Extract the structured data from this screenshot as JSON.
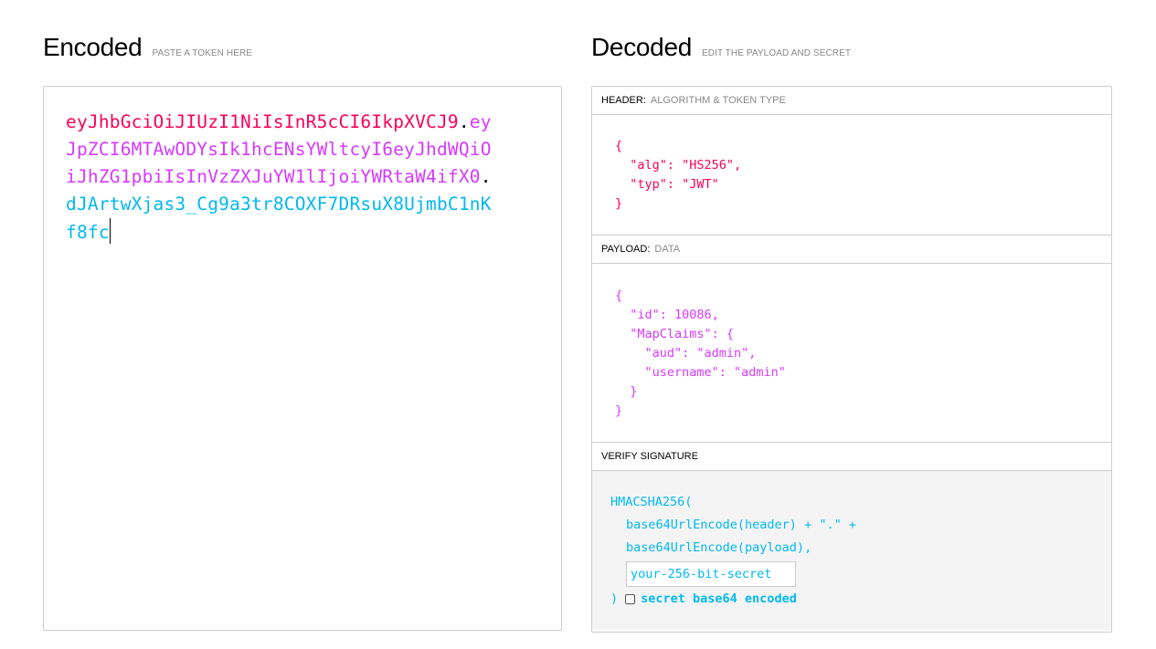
{
  "encoded": {
    "title": "Encoded",
    "subtitle": "PASTE A TOKEN HERE",
    "token": {
      "header": "eyJhbGciOiJIUzI1NiIsInR5cCI6IkpXVCJ9",
      "dot1": ".",
      "payload": "eyJpZCI6MTAwODYsIk1hcENsYWltcyI6eyJhdWQiOiJhZG1pbiIsInVzZXJuYW1lIjoiYWRtaW4ifX0",
      "dot2": ".",
      "signature": "dJArtwXjas3_Cg9a3tr8COXF7DRsuX8UjmbC1nKf8fc"
    }
  },
  "decoded": {
    "title": "Decoded",
    "subtitle": "EDIT THE PAYLOAD AND SECRET",
    "header_section": {
      "label": "HEADER:",
      "hint": "ALGORITHM & TOKEN TYPE",
      "lines": [
        "{",
        "  \"alg\": \"HS256\",",
        "  \"typ\": \"JWT\"",
        "}"
      ]
    },
    "payload_section": {
      "label": "PAYLOAD:",
      "hint": "DATA",
      "lines": [
        "{",
        "  \"id\": 10086,",
        "  \"MapClaims\": {",
        "    \"aud\": \"admin\",",
        "    \"username\": \"admin\"",
        "  }",
        "}"
      ]
    },
    "verify_section": {
      "label": "VERIFY SIGNATURE",
      "line1": "HMACSHA256(",
      "line2": "base64UrlEncode(header) + \".\" +",
      "line3": "base64UrlEncode(payload),",
      "secret_placeholder": "your-256-bit-secret",
      "close": ")",
      "checkbox_label": "secret base64 encoded",
      "checkbox_checked": false
    }
  },
  "colors": {
    "header": "#fb015b",
    "payload": "#d63aff",
    "signature": "#00b9f1"
  }
}
